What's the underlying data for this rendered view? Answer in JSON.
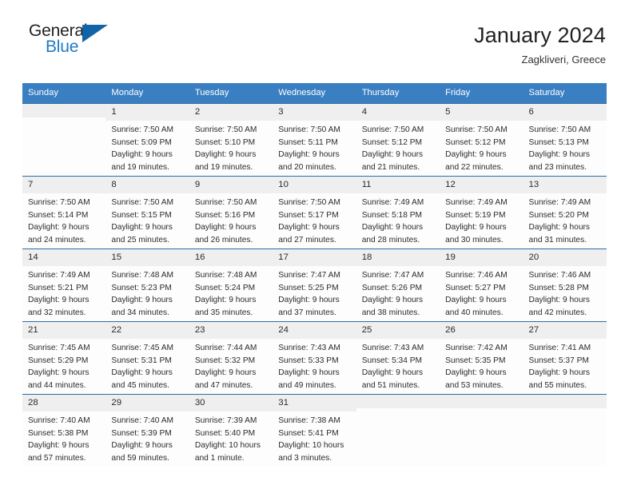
{
  "brand": {
    "general": "General",
    "blue": "Blue",
    "triangle_color": "#1064a8"
  },
  "header": {
    "title": "January 2024",
    "location": "Zagkliveri, Greece"
  },
  "theme": {
    "header_bg": "#3a7fc1",
    "row_divider": "#2e6da4",
    "day_number_bg": "#efefef",
    "text": "#2b2b2b"
  },
  "weekdays": [
    "Sunday",
    "Monday",
    "Tuesday",
    "Wednesday",
    "Thursday",
    "Friday",
    "Saturday"
  ],
  "weeks": [
    [
      {
        "day": "",
        "sunrise": "",
        "sunset": "",
        "daylight": "",
        "empty": true
      },
      {
        "day": "1",
        "sunrise": "Sunrise: 7:50 AM",
        "sunset": "Sunset: 5:09 PM",
        "daylight": "Daylight: 9 hours and 19 minutes."
      },
      {
        "day": "2",
        "sunrise": "Sunrise: 7:50 AM",
        "sunset": "Sunset: 5:10 PM",
        "daylight": "Daylight: 9 hours and 19 minutes."
      },
      {
        "day": "3",
        "sunrise": "Sunrise: 7:50 AM",
        "sunset": "Sunset: 5:11 PM",
        "daylight": "Daylight: 9 hours and 20 minutes."
      },
      {
        "day": "4",
        "sunrise": "Sunrise: 7:50 AM",
        "sunset": "Sunset: 5:12 PM",
        "daylight": "Daylight: 9 hours and 21 minutes."
      },
      {
        "day": "5",
        "sunrise": "Sunrise: 7:50 AM",
        "sunset": "Sunset: 5:12 PM",
        "daylight": "Daylight: 9 hours and 22 minutes."
      },
      {
        "day": "6",
        "sunrise": "Sunrise: 7:50 AM",
        "sunset": "Sunset: 5:13 PM",
        "daylight": "Daylight: 9 hours and 23 minutes."
      }
    ],
    [
      {
        "day": "7",
        "sunrise": "Sunrise: 7:50 AM",
        "sunset": "Sunset: 5:14 PM",
        "daylight": "Daylight: 9 hours and 24 minutes."
      },
      {
        "day": "8",
        "sunrise": "Sunrise: 7:50 AM",
        "sunset": "Sunset: 5:15 PM",
        "daylight": "Daylight: 9 hours and 25 minutes."
      },
      {
        "day": "9",
        "sunrise": "Sunrise: 7:50 AM",
        "sunset": "Sunset: 5:16 PM",
        "daylight": "Daylight: 9 hours and 26 minutes."
      },
      {
        "day": "10",
        "sunrise": "Sunrise: 7:50 AM",
        "sunset": "Sunset: 5:17 PM",
        "daylight": "Daylight: 9 hours and 27 minutes."
      },
      {
        "day": "11",
        "sunrise": "Sunrise: 7:49 AM",
        "sunset": "Sunset: 5:18 PM",
        "daylight": "Daylight: 9 hours and 28 minutes."
      },
      {
        "day": "12",
        "sunrise": "Sunrise: 7:49 AM",
        "sunset": "Sunset: 5:19 PM",
        "daylight": "Daylight: 9 hours and 30 minutes."
      },
      {
        "day": "13",
        "sunrise": "Sunrise: 7:49 AM",
        "sunset": "Sunset: 5:20 PM",
        "daylight": "Daylight: 9 hours and 31 minutes."
      }
    ],
    [
      {
        "day": "14",
        "sunrise": "Sunrise: 7:49 AM",
        "sunset": "Sunset: 5:21 PM",
        "daylight": "Daylight: 9 hours and 32 minutes."
      },
      {
        "day": "15",
        "sunrise": "Sunrise: 7:48 AM",
        "sunset": "Sunset: 5:23 PM",
        "daylight": "Daylight: 9 hours and 34 minutes."
      },
      {
        "day": "16",
        "sunrise": "Sunrise: 7:48 AM",
        "sunset": "Sunset: 5:24 PM",
        "daylight": "Daylight: 9 hours and 35 minutes."
      },
      {
        "day": "17",
        "sunrise": "Sunrise: 7:47 AM",
        "sunset": "Sunset: 5:25 PM",
        "daylight": "Daylight: 9 hours and 37 minutes."
      },
      {
        "day": "18",
        "sunrise": "Sunrise: 7:47 AM",
        "sunset": "Sunset: 5:26 PM",
        "daylight": "Daylight: 9 hours and 38 minutes."
      },
      {
        "day": "19",
        "sunrise": "Sunrise: 7:46 AM",
        "sunset": "Sunset: 5:27 PM",
        "daylight": "Daylight: 9 hours and 40 minutes."
      },
      {
        "day": "20",
        "sunrise": "Sunrise: 7:46 AM",
        "sunset": "Sunset: 5:28 PM",
        "daylight": "Daylight: 9 hours and 42 minutes."
      }
    ],
    [
      {
        "day": "21",
        "sunrise": "Sunrise: 7:45 AM",
        "sunset": "Sunset: 5:29 PM",
        "daylight": "Daylight: 9 hours and 44 minutes."
      },
      {
        "day": "22",
        "sunrise": "Sunrise: 7:45 AM",
        "sunset": "Sunset: 5:31 PM",
        "daylight": "Daylight: 9 hours and 45 minutes."
      },
      {
        "day": "23",
        "sunrise": "Sunrise: 7:44 AM",
        "sunset": "Sunset: 5:32 PM",
        "daylight": "Daylight: 9 hours and 47 minutes."
      },
      {
        "day": "24",
        "sunrise": "Sunrise: 7:43 AM",
        "sunset": "Sunset: 5:33 PM",
        "daylight": "Daylight: 9 hours and 49 minutes."
      },
      {
        "day": "25",
        "sunrise": "Sunrise: 7:43 AM",
        "sunset": "Sunset: 5:34 PM",
        "daylight": "Daylight: 9 hours and 51 minutes."
      },
      {
        "day": "26",
        "sunrise": "Sunrise: 7:42 AM",
        "sunset": "Sunset: 5:35 PM",
        "daylight": "Daylight: 9 hours and 53 minutes."
      },
      {
        "day": "27",
        "sunrise": "Sunrise: 7:41 AM",
        "sunset": "Sunset: 5:37 PM",
        "daylight": "Daylight: 9 hours and 55 minutes."
      }
    ],
    [
      {
        "day": "28",
        "sunrise": "Sunrise: 7:40 AM",
        "sunset": "Sunset: 5:38 PM",
        "daylight": "Daylight: 9 hours and 57 minutes."
      },
      {
        "day": "29",
        "sunrise": "Sunrise: 7:40 AM",
        "sunset": "Sunset: 5:39 PM",
        "daylight": "Daylight: 9 hours and 59 minutes."
      },
      {
        "day": "30",
        "sunrise": "Sunrise: 7:39 AM",
        "sunset": "Sunset: 5:40 PM",
        "daylight": "Daylight: 10 hours and 1 minute."
      },
      {
        "day": "31",
        "sunrise": "Sunrise: 7:38 AM",
        "sunset": "Sunset: 5:41 PM",
        "daylight": "Daylight: 10 hours and 3 minutes."
      },
      {
        "day": "",
        "sunrise": "",
        "sunset": "",
        "daylight": "",
        "empty": true
      },
      {
        "day": "",
        "sunrise": "",
        "sunset": "",
        "daylight": "",
        "empty": true
      },
      {
        "day": "",
        "sunrise": "",
        "sunset": "",
        "daylight": "",
        "empty": true
      }
    ]
  ]
}
